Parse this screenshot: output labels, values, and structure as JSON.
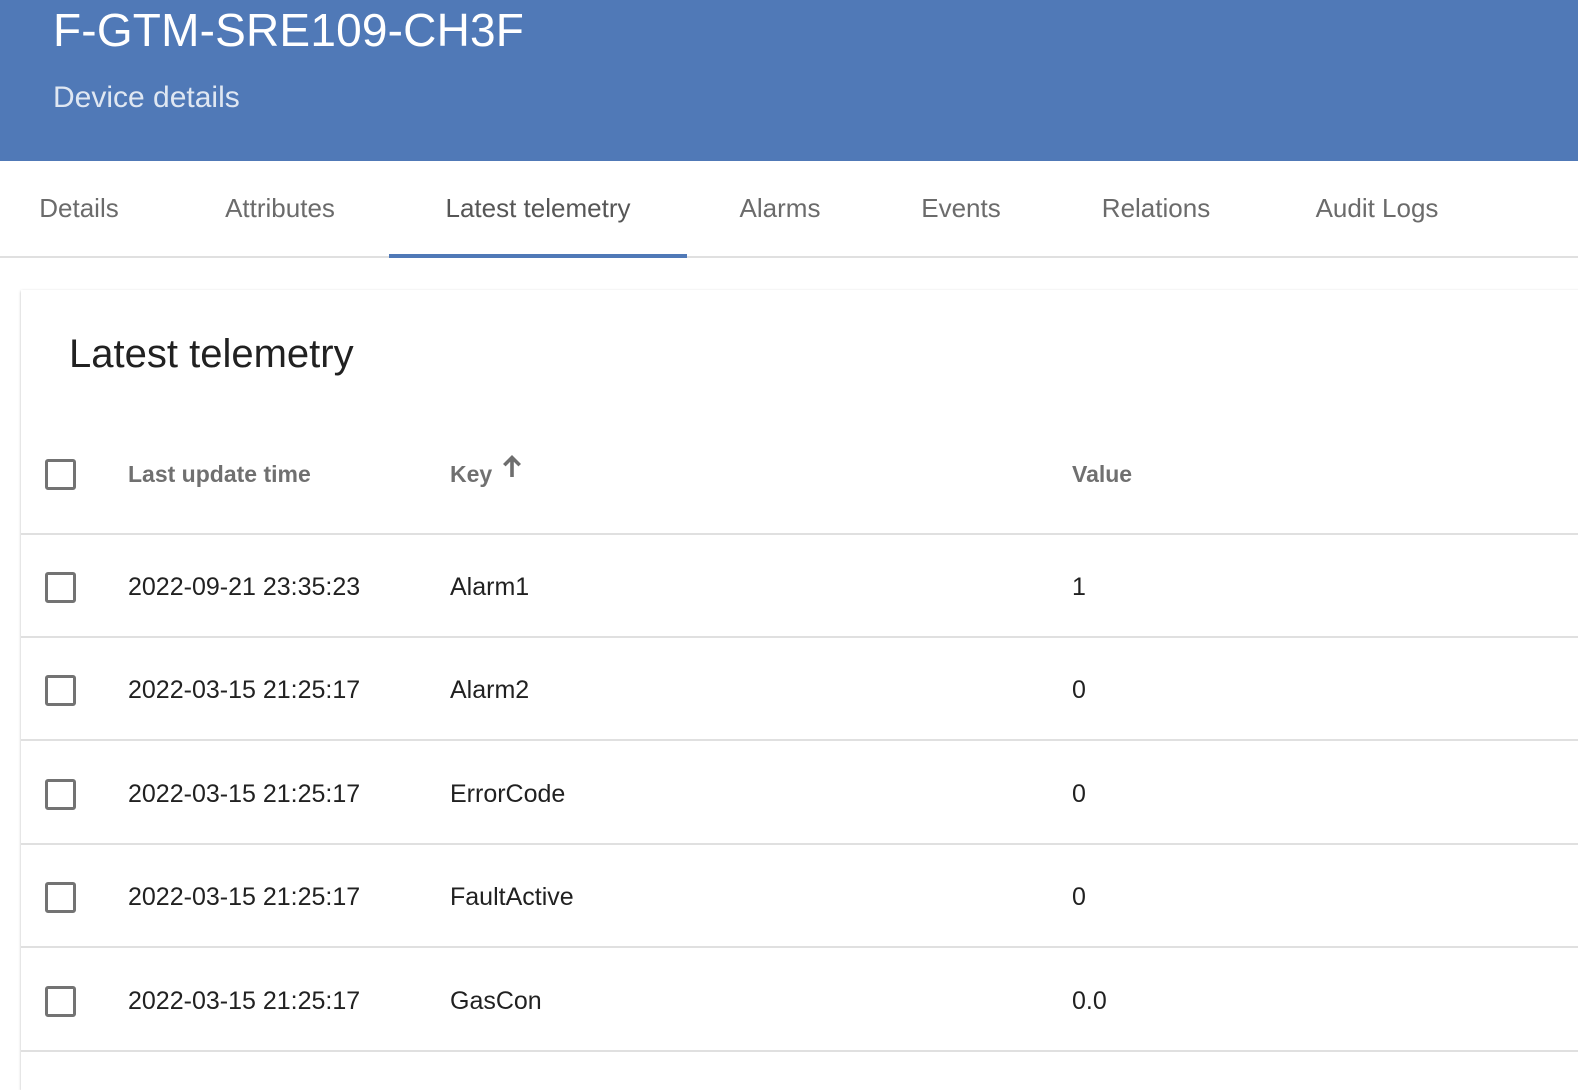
{
  "header": {
    "title": "F-GTM-SRE109-CH3F",
    "subtitle": "Device details",
    "color": "#5079b7"
  },
  "tabs": [
    {
      "label": "Details",
      "active": false
    },
    {
      "label": "Attributes",
      "active": false
    },
    {
      "label": "Latest telemetry",
      "active": true
    },
    {
      "label": "Alarms",
      "active": false
    },
    {
      "label": "Events",
      "active": false
    },
    {
      "label": "Relations",
      "active": false
    },
    {
      "label": "Audit Logs",
      "active": false
    }
  ],
  "panel": {
    "title": "Latest telemetry",
    "columns": {
      "last_update_time": "Last update time",
      "key": "Key",
      "value": "Value"
    },
    "sort": {
      "column": "key",
      "direction": "ascending",
      "icon": "arrow-up-icon"
    },
    "rows": [
      {
        "last_update_time": "2022-09-21 23:35:23",
        "key": "Alarm1",
        "value": "1"
      },
      {
        "last_update_time": "2022-03-15 21:25:17",
        "key": "Alarm2",
        "value": "0"
      },
      {
        "last_update_time": "2022-03-15 21:25:17",
        "key": "ErrorCode",
        "value": "0"
      },
      {
        "last_update_time": "2022-03-15 21:25:17",
        "key": "FaultActive",
        "value": "0"
      },
      {
        "last_update_time": "2022-03-15 21:25:17",
        "key": "GasCon",
        "value": "0.0"
      }
    ]
  }
}
